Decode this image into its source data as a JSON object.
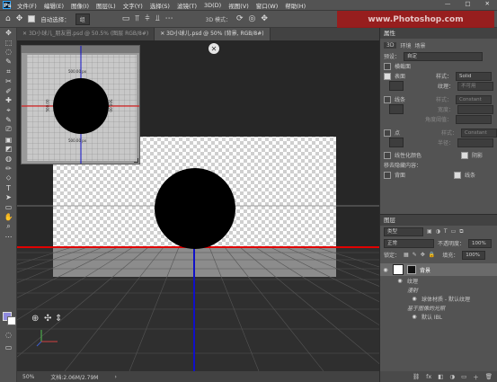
{
  "menubar": {
    "logo": "Ps",
    "items": [
      "文件(F)",
      "编辑(E)",
      "图像(I)",
      "图层(L)",
      "文字(Y)",
      "选择(S)",
      "滤镜(T)",
      "3D(D)",
      "视图(V)",
      "窗口(W)",
      "帮助(H)"
    ],
    "win_minimize": "—",
    "win_maximize": "□",
    "win_close": "✕"
  },
  "options": {
    "auto_select_label": "自动选择：",
    "auto_select_value": "组",
    "mode_label": "3D 模式：",
    "watermark": "www.Photoshop.com"
  },
  "tools": [
    "✥",
    "⬚",
    "◌",
    "✎",
    "⌗",
    "✂",
    "✐",
    "✚",
    "⌖",
    "✎",
    "⎚",
    "▣",
    "◩",
    "◍",
    "✏",
    "⬦",
    "T",
    "➤",
    "▭",
    "✋",
    "⌕",
    "⋯"
  ],
  "tabs": [
    {
      "label": "3D小球儿_朋友圈.psd @ 50.5% (图层 RGB/8#)",
      "close": "✕",
      "active": false
    },
    {
      "label": "3D小球儿.psd @ 50% (背景, RGB/8#)",
      "close": "✕",
      "active": true
    }
  ],
  "preview": {
    "label_top": "500.00 px",
    "label_bottom": "500.00 px",
    "label_left": "500.00",
    "label_right": "500.00"
  },
  "status": {
    "zoom": "50%",
    "doc": "文档:2.06M/2.79M",
    "arrow": "›"
  },
  "properties": {
    "title": "属性",
    "tabs": [
      "3D",
      "环境",
      "场景"
    ],
    "preset_label": "预设：",
    "preset_value": "自定",
    "cross_section": "横截面",
    "surface": "表面",
    "surface_style_label": "样式：",
    "surface_style_value": "Solid",
    "texture_label": "纹理：",
    "texture_value": "不可用",
    "lines": "线条",
    "lines_style_label": "样式：",
    "lines_style_value": "Constant",
    "width_label": "宽度：",
    "angle_label": "角度阈值：",
    "points": "点",
    "points_style_label": "样式：",
    "points_style_value": "Constant",
    "radius_label": "半径：",
    "linearize": "线性化颜色",
    "shadow": "阴影",
    "remove_hidden": "移去隐藏内容：",
    "backface": "背面",
    "line_cb": "线条"
  },
  "layers": {
    "title": "图层",
    "filter_label": "类型",
    "blend": "正常",
    "opacity_label": "不透明度：",
    "opacity_value": "100%",
    "lock_label": "锁定：",
    "fill_label": "填充：",
    "fill_value": "100%",
    "items": [
      {
        "name": "背景",
        "indent": 0
      },
      {
        "name": "纹理",
        "indent": 1
      },
      {
        "name": "漫射",
        "indent": 2
      },
      {
        "name": "球体材质 - 默认纹理",
        "indent": 3
      },
      {
        "name": "基于图像的光照",
        "indent": 2
      },
      {
        "name": "默认 IBL",
        "indent": 3
      }
    ],
    "footer_icons": [
      "⛓",
      "fx",
      "◧",
      "◑",
      "▭",
      "＋",
      "🗑"
    ]
  }
}
